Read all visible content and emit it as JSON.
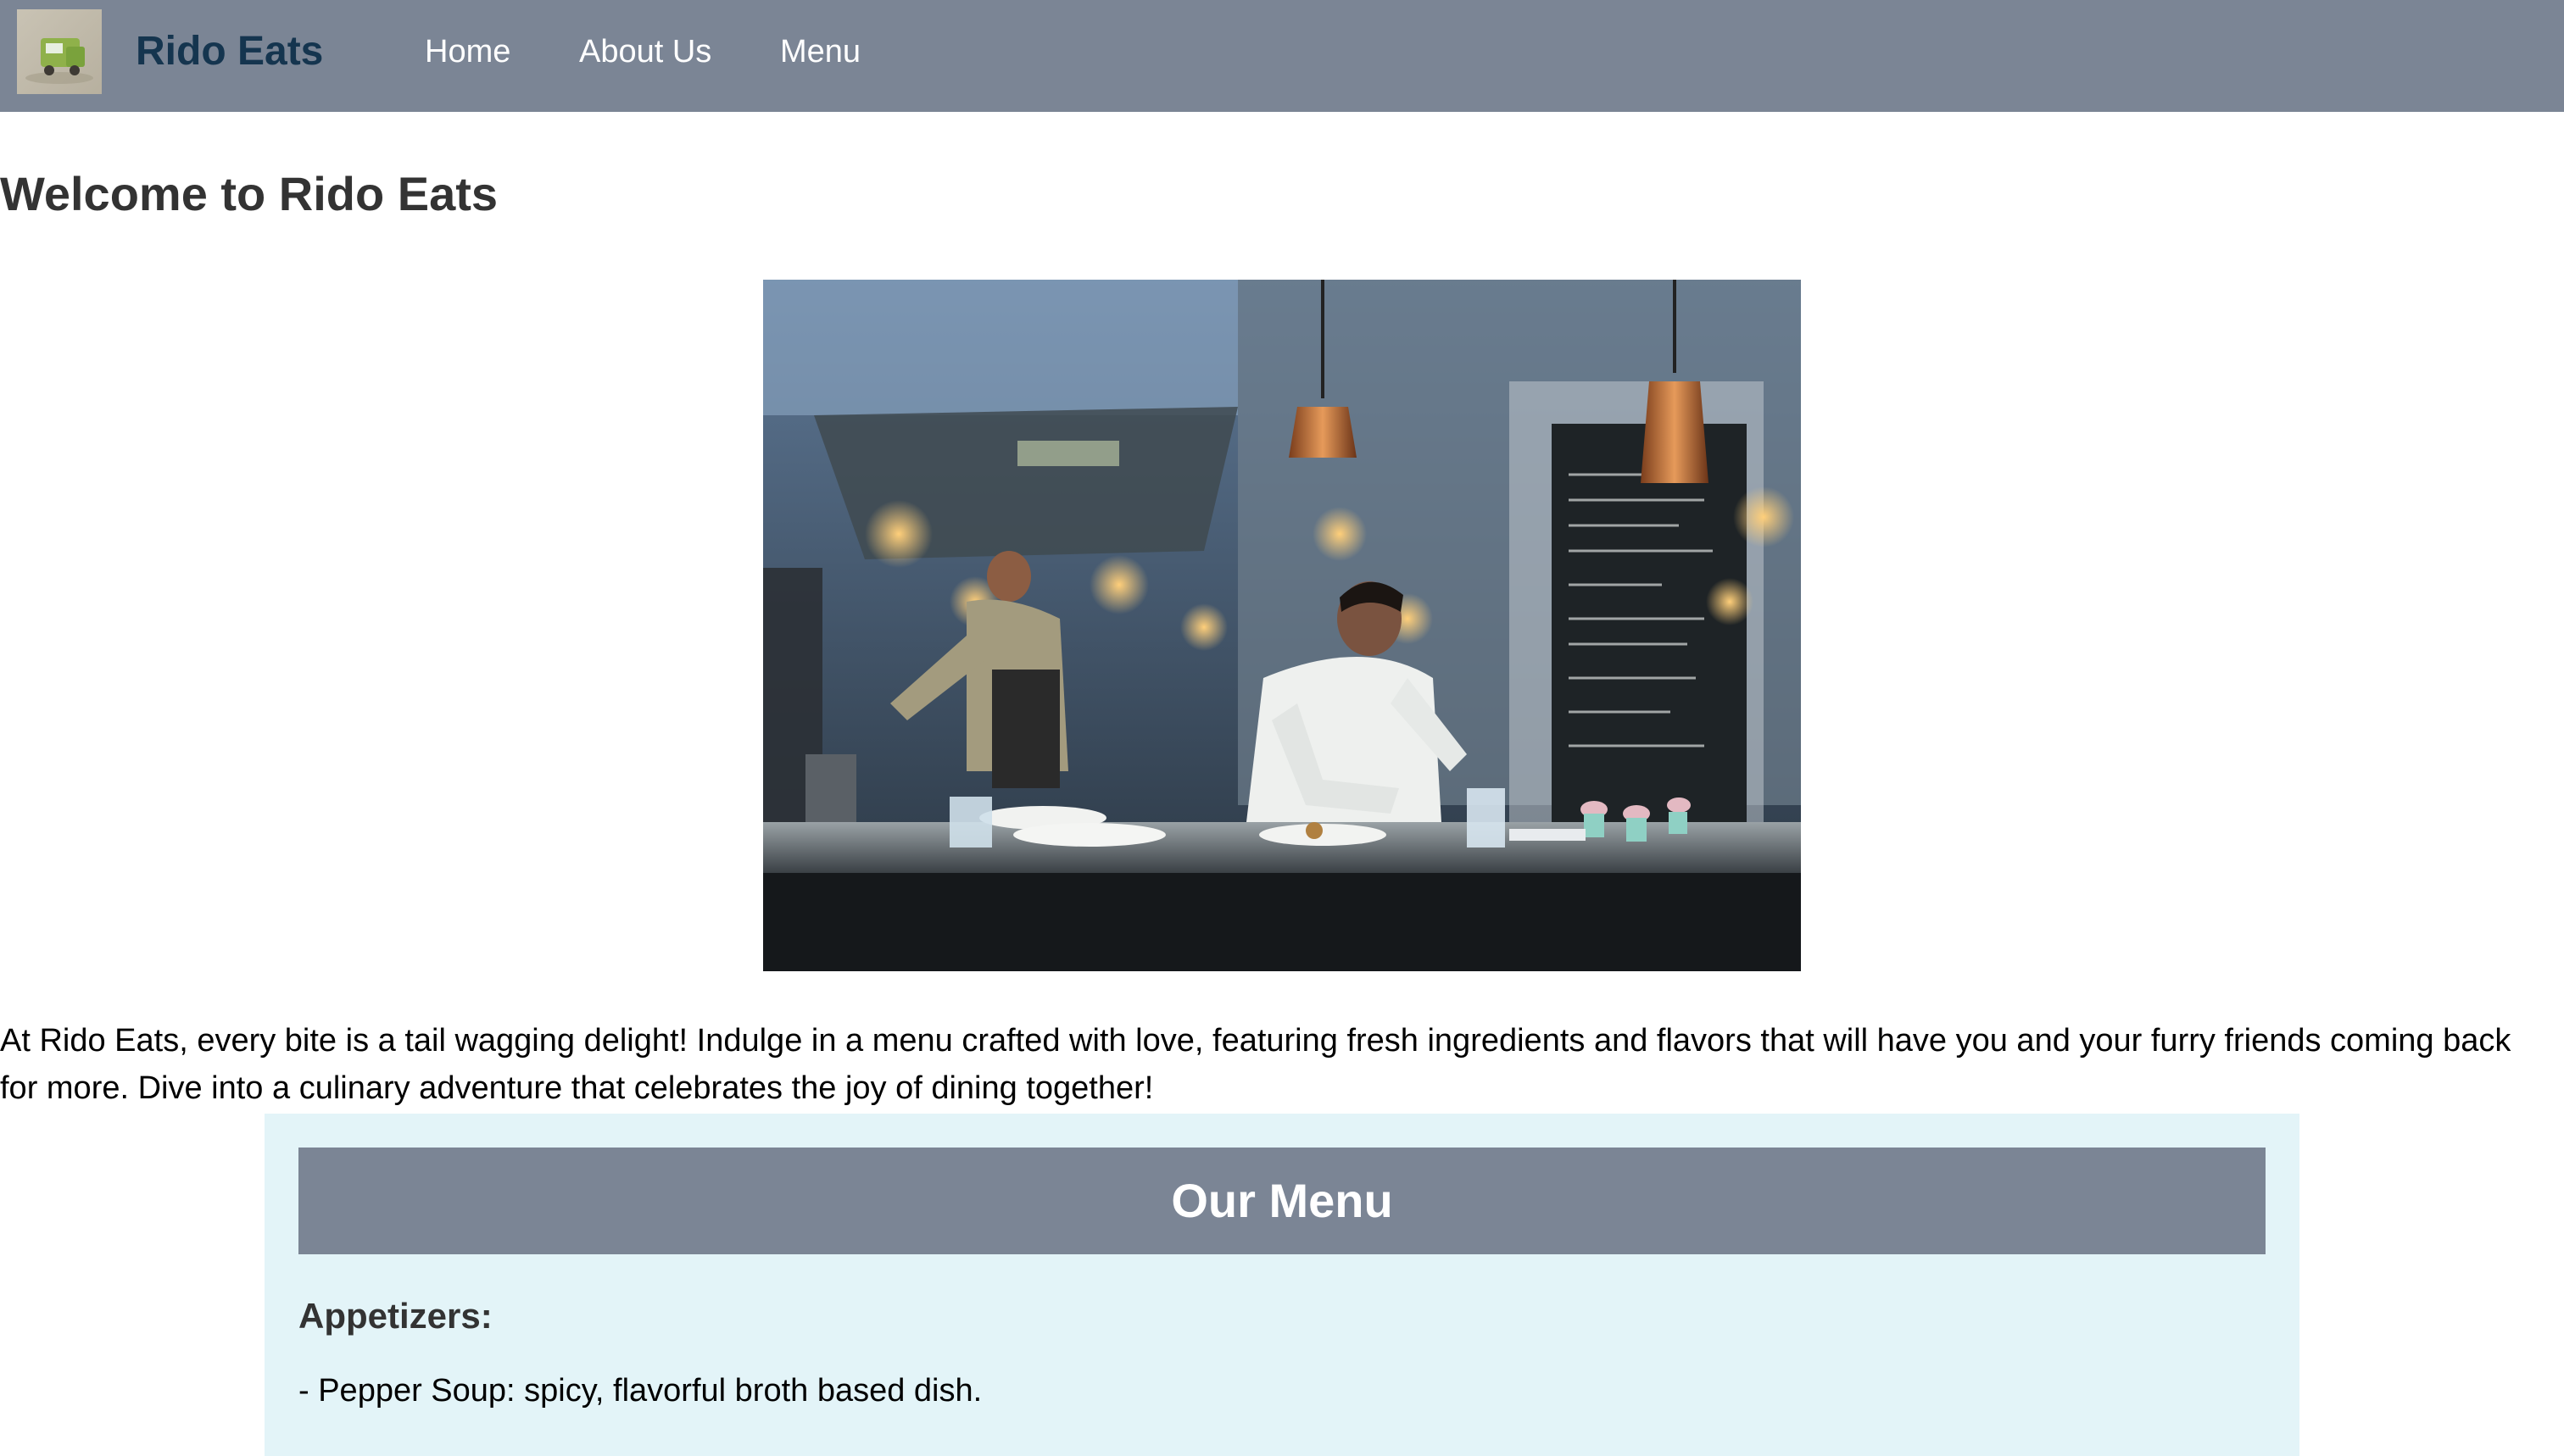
{
  "nav": {
    "logo_icon": "food-truck-logo",
    "brand": "Rido Eats",
    "links": [
      "Home",
      "About Us",
      "Menu"
    ],
    "background_color": "#7b8595",
    "brand_color": "#15354f"
  },
  "main": {
    "heading": "Welcome to Rido Eats",
    "intro": "At Rido Eats, every bite is a tail wagging delight! Indulge in a menu crafted with love, featuring fresh ingredients and flavors that will have you and your furry friends coming back for more. Dive into a culinary adventure that celebrates the joy of dining together!"
  },
  "menu": {
    "heading": "Our Menu",
    "section_background": "#e3f4f8",
    "categories": [
      {
        "title": "Appetizers:",
        "items": [
          "- Pepper Soup: spicy, flavorful broth based dish."
        ]
      }
    ]
  }
}
